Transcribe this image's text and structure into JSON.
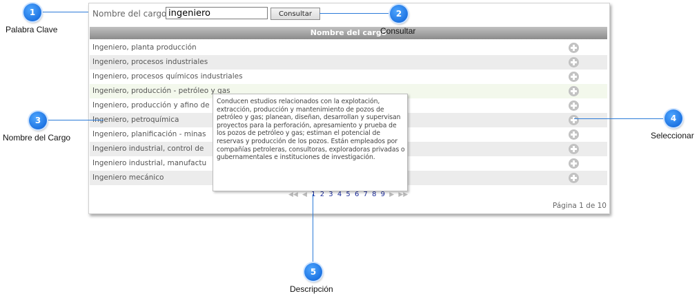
{
  "search": {
    "label": "Nombre del cargo",
    "value": "ingeniero",
    "button_label": "Consultar"
  },
  "table": {
    "header": "Nombre del cargo",
    "rows": [
      "Ingeniero, planta producción",
      "Ingeniero, procesos industriales",
      "Ingeniero, procesos químicos industriales",
      "Ingeniero, producción - petróleo y gas",
      "Ingeniero, producción y afino de",
      "Ingeniero, petroquímica",
      "Ingeniero, planificación - minas",
      "Ingeniero industrial, control de",
      "Ingeniero industrial, manufactu",
      "Ingeniero mecánico"
    ],
    "add_icon": "plus-circle-icon"
  },
  "tooltip": {
    "text": "Conducen estudios relacionados con la explotación, extracción, producción y mantenimiento de pozos de petróleo y gas; planean, diseñan, desarrollan y supervisan proyectos para la perforación, apresamiento y prueba de los pozos de petróleo y gas; estiman el potencial de reservas y producción de los pozos. Están empleados por compañías petroleras, consultoras, exploradoras privadas o gubernamentales e instituciones de investigación."
  },
  "pager": {
    "first": "◀◀",
    "prev": "◀",
    "pages": [
      "1",
      "2",
      "3",
      "4",
      "5",
      "6",
      "7",
      "8",
      "9"
    ],
    "next": "▶",
    "last": "▶▶",
    "info": "Página 1 de 10"
  },
  "callouts": [
    {
      "number": "1",
      "label": "Palabra Clave"
    },
    {
      "number": "2",
      "label": "Consultar"
    },
    {
      "number": "3",
      "label": "Nombre del Cargo"
    },
    {
      "number": "4",
      "label": "Seleccionar"
    },
    {
      "number": "5",
      "label": "Descripción"
    }
  ],
  "colors": {
    "callout_blue": "#1a73e8",
    "header_gray": "#9a9a9a",
    "row_alt": "#ececec",
    "link_blue": "#1a2a9a"
  }
}
